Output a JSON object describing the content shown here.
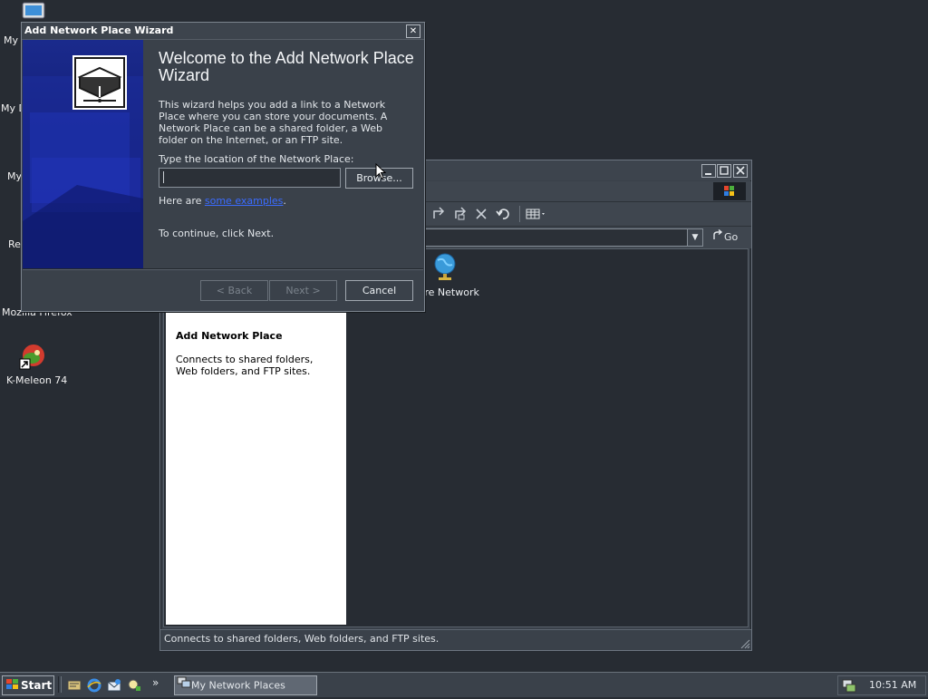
{
  "desktop": {
    "icons": [
      {
        "label": "My"
      },
      {
        "label": "My D"
      },
      {
        "label": "My"
      },
      {
        "label": "Re"
      },
      {
        "label": "Mozilla Firefox"
      },
      {
        "label": "K-Meleon 74"
      }
    ]
  },
  "explorer": {
    "address_go": "Go",
    "content": {
      "network_item": "tire Network"
    },
    "task_pane": {
      "title": "Add Network Place",
      "description": "Connects to shared folders, Web folders, and FTP sites."
    },
    "status": "Connects to shared folders, Web folders, and FTP sites."
  },
  "wizard": {
    "title": "Add Network Place Wizard",
    "close_glyph": "✕",
    "heading": "Welcome to the Add Network Place Wizard",
    "intro": "This wizard helps you add a link to a Network Place where you can store your documents. A Network Place can be a shared folder, a Web folder on the Internet, or an FTP site.",
    "location_label": "Type the location of the Network Place:",
    "location_value": "",
    "browse_label": "Browse...",
    "examples_prefix": "Here are ",
    "examples_link": "some examples",
    "examples_suffix": ".",
    "continue_text": "To continue, click Next.",
    "back_label": "< Back",
    "next_label": "Next >",
    "cancel_label": "Cancel"
  },
  "taskbar": {
    "start_label": "Start",
    "chevron": "»",
    "active_task": "My Network Places",
    "clock": "10:51 AM"
  }
}
